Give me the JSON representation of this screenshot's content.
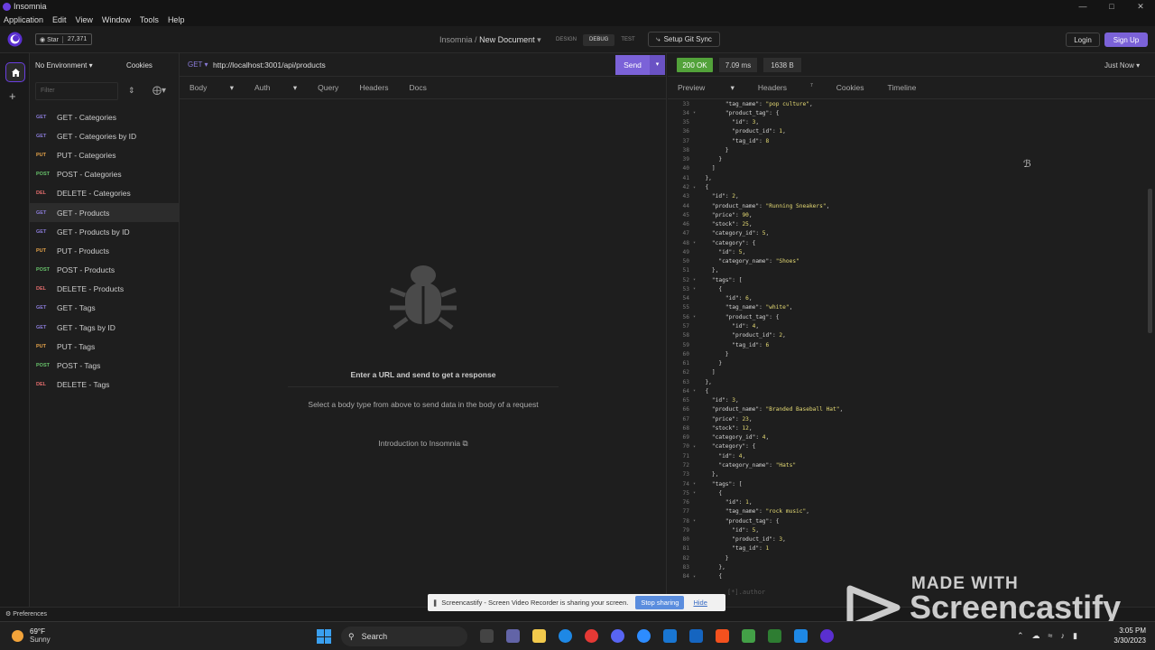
{
  "window": {
    "title": "Insomnia",
    "controls": [
      "—",
      "□",
      "✕"
    ]
  },
  "menu": [
    "Application",
    "Edit",
    "View",
    "Window",
    "Tools",
    "Help"
  ],
  "topbar": {
    "star_label": "Star",
    "star_count": "27,371",
    "breadcrumb_root": "Insomnia",
    "breadcrumb_sep": "/",
    "document_name": "New Document",
    "modes": [
      "DESIGN",
      "DEBUG",
      "TEST"
    ],
    "active_mode": "DEBUG",
    "git_sync": "Setup Git Sync",
    "login": "Login",
    "signup": "Sign Up"
  },
  "sidebar": {
    "environment": "No Environment",
    "cookies": "Cookies",
    "filter_placeholder": "Filter",
    "requests": [
      {
        "method": "GET",
        "name": "GET - Categories",
        "active": false
      },
      {
        "method": "GET",
        "name": "GET - Categories by ID",
        "active": false
      },
      {
        "method": "PUT",
        "name": "PUT - Categories",
        "active": false
      },
      {
        "method": "POST",
        "name": "POST - Categories",
        "active": false
      },
      {
        "method": "DEL",
        "name": "DELETE - Categories",
        "active": false
      },
      {
        "method": "GET",
        "name": "GET - Products",
        "active": true
      },
      {
        "method": "GET",
        "name": "GET - Products by ID",
        "active": false
      },
      {
        "method": "PUT",
        "name": "PUT - Products",
        "active": false
      },
      {
        "method": "POST",
        "name": "POST - Products",
        "active": false
      },
      {
        "method": "DEL",
        "name": "DELETE - Products",
        "active": false
      },
      {
        "method": "GET",
        "name": "GET - Tags",
        "active": false
      },
      {
        "method": "GET",
        "name": "GET - Tags by ID",
        "active": false
      },
      {
        "method": "PUT",
        "name": "PUT - Tags",
        "active": false
      },
      {
        "method": "POST",
        "name": "POST - Tags",
        "active": false
      },
      {
        "method": "DEL",
        "name": "DELETE - Tags",
        "active": false
      }
    ],
    "preferences": "Preferences"
  },
  "request": {
    "method": "GET",
    "url": "http://localhost:3001/api/products",
    "send": "Send",
    "tabs": [
      "Body",
      "Auth",
      "Query",
      "Headers",
      "Docs"
    ],
    "empty_title": "Enter a URL and send to get a response",
    "empty_sub": "Select a body type from above to send data in the body of a request",
    "intro_link": "Introduction to Insomnia"
  },
  "response": {
    "status": "200 OK",
    "time": "7.09 ms",
    "size": "1638 B",
    "when": "Just Now",
    "tabs": [
      "Preview",
      "Headers",
      "Cookies",
      "Timeline"
    ],
    "headers_count": "7",
    "footer_hint": "[*].author",
    "lines": [
      {
        "n": "33",
        "t": "        \"tag_name\": \"pop culture\","
      },
      {
        "n": "34",
        "t": "        \"product_tag\": {",
        "f": true
      },
      {
        "n": "35",
        "t": "          \"id\": 3,"
      },
      {
        "n": "36",
        "t": "          \"product_id\": 1,"
      },
      {
        "n": "37",
        "t": "          \"tag_id\": 8"
      },
      {
        "n": "38",
        "t": "        }"
      },
      {
        "n": "39",
        "t": "      }"
      },
      {
        "n": "40",
        "t": "    ]"
      },
      {
        "n": "41",
        "t": "  },"
      },
      {
        "n": "42",
        "t": "  {",
        "f": true
      },
      {
        "n": "43",
        "t": "    \"id\": 2,"
      },
      {
        "n": "44",
        "t": "    \"product_name\": \"Running Sneakers\","
      },
      {
        "n": "45",
        "t": "    \"price\": 90,"
      },
      {
        "n": "46",
        "t": "    \"stock\": 25,"
      },
      {
        "n": "47",
        "t": "    \"category_id\": 5,"
      },
      {
        "n": "48",
        "t": "    \"category\": {",
        "f": true
      },
      {
        "n": "49",
        "t": "      \"id\": 5,"
      },
      {
        "n": "50",
        "t": "      \"category_name\": \"Shoes\""
      },
      {
        "n": "51",
        "t": "    },"
      },
      {
        "n": "52",
        "t": "    \"tags\": [",
        "f": true
      },
      {
        "n": "53",
        "t": "      {",
        "f": true
      },
      {
        "n": "54",
        "t": "        \"id\": 6,"
      },
      {
        "n": "55",
        "t": "        \"tag_name\": \"white\","
      },
      {
        "n": "56",
        "t": "        \"product_tag\": {",
        "f": true
      },
      {
        "n": "57",
        "t": "          \"id\": 4,"
      },
      {
        "n": "58",
        "t": "          \"product_id\": 2,"
      },
      {
        "n": "59",
        "t": "          \"tag_id\": 6"
      },
      {
        "n": "60",
        "t": "        }"
      },
      {
        "n": "61",
        "t": "      }"
      },
      {
        "n": "62",
        "t": "    ]"
      },
      {
        "n": "63",
        "t": "  },"
      },
      {
        "n": "64",
        "t": "  {",
        "f": true
      },
      {
        "n": "65",
        "t": "    \"id\": 3,"
      },
      {
        "n": "66",
        "t": "    \"product_name\": \"Branded Baseball Hat\","
      },
      {
        "n": "67",
        "t": "    \"price\": 23,"
      },
      {
        "n": "68",
        "t": "    \"stock\": 12,"
      },
      {
        "n": "69",
        "t": "    \"category_id\": 4,"
      },
      {
        "n": "70",
        "t": "    \"category\": {",
        "f": true
      },
      {
        "n": "71",
        "t": "      \"id\": 4,"
      },
      {
        "n": "72",
        "t": "      \"category_name\": \"Hats\""
      },
      {
        "n": "73",
        "t": "    },"
      },
      {
        "n": "74",
        "t": "    \"tags\": [",
        "f": true
      },
      {
        "n": "75",
        "t": "      {",
        "f": true
      },
      {
        "n": "76",
        "t": "        \"id\": 1,"
      },
      {
        "n": "77",
        "t": "        \"tag_name\": \"rock music\","
      },
      {
        "n": "78",
        "t": "        \"product_tag\": {",
        "f": true
      },
      {
        "n": "79",
        "t": "          \"id\": 5,"
      },
      {
        "n": "80",
        "t": "          \"product_id\": 3,"
      },
      {
        "n": "81",
        "t": "          \"tag_id\": 1"
      },
      {
        "n": "82",
        "t": "        }"
      },
      {
        "n": "83",
        "t": "      },"
      },
      {
        "n": "84",
        "t": "      {",
        "f": true
      }
    ]
  },
  "share_bar": {
    "message": "Screencastify - Screen Video Recorder is sharing your screen.",
    "stop": "Stop sharing",
    "hide": "Hide"
  },
  "watermark": {
    "line1": "MADE WITH",
    "line2": "Screencastify"
  },
  "taskbar": {
    "temp": "69°F",
    "weather": "Sunny",
    "search": "Search",
    "time": "3:05 PM",
    "date": "3/30/2023"
  },
  "colors": {
    "accent": "#7b62d8",
    "ok": "#52a23a",
    "get": "#8a7bd8",
    "put": "#e5a34a",
    "post": "#68c46b",
    "delete": "#e26c6c"
  }
}
